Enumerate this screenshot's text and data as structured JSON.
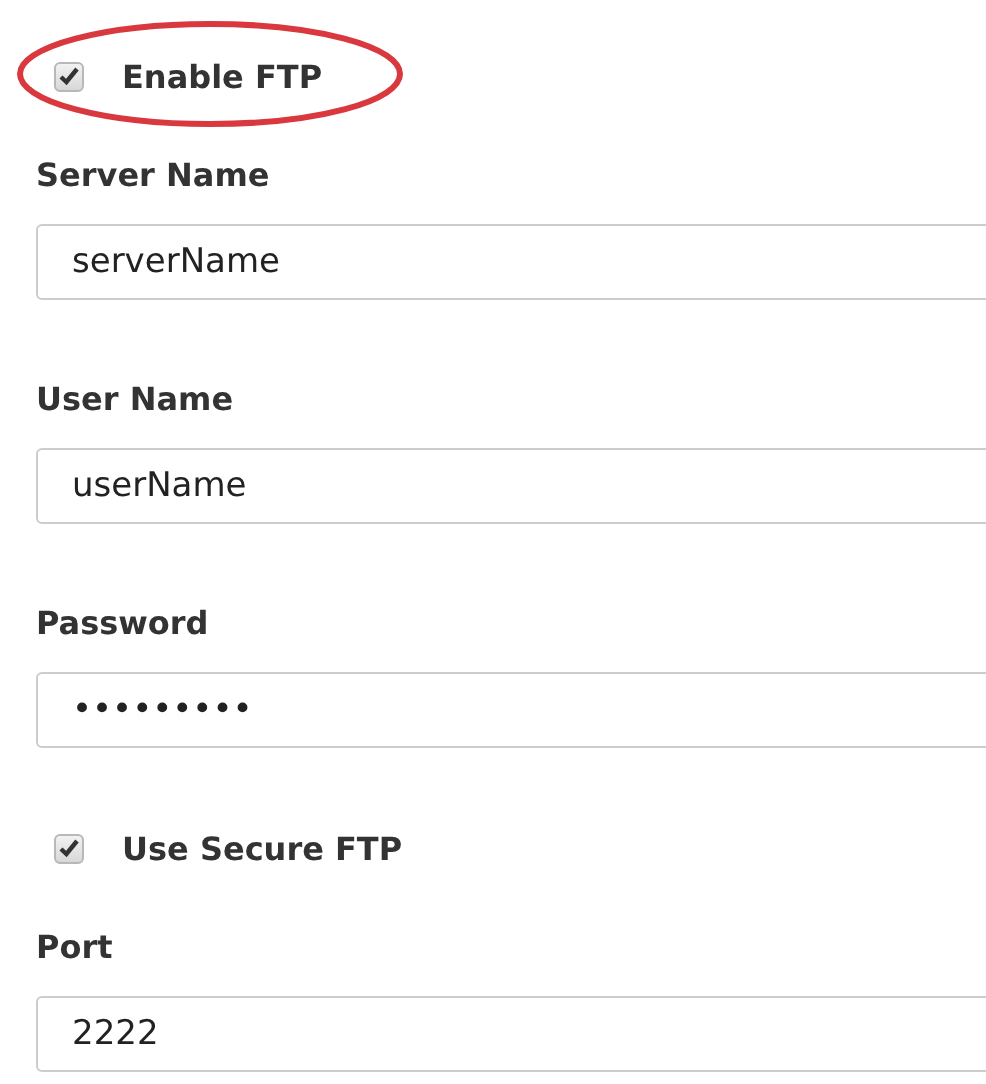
{
  "form": {
    "items": [
      {
        "kind": "checkbox",
        "label": "Enable FTP",
        "checked": true,
        "highlighted": true
      },
      {
        "kind": "field",
        "label": "Server Name",
        "value": "serverName"
      },
      {
        "kind": "field",
        "label": "User Name",
        "value": "userName"
      },
      {
        "kind": "field",
        "label": "Password",
        "value": "•••••••••"
      },
      {
        "kind": "checkbox",
        "label": "Use Secure FTP",
        "checked": true,
        "highlighted": false
      },
      {
        "kind": "field",
        "label": "Port",
        "value": "2222"
      }
    ]
  }
}
